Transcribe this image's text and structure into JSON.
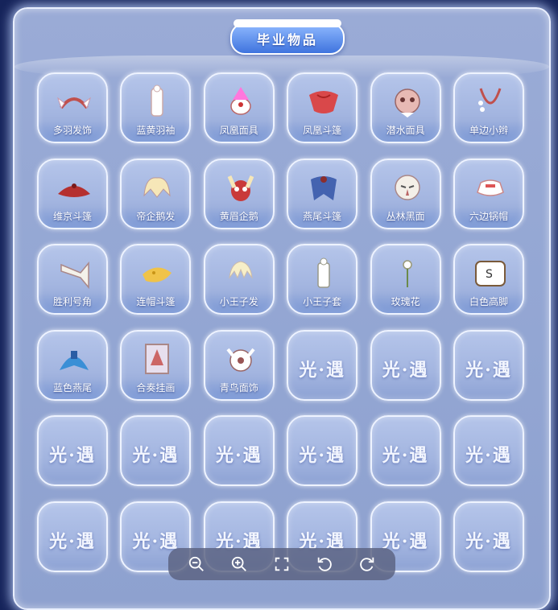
{
  "title": "毕业物品",
  "items": [
    {
      "label": "多羽发饰",
      "icon": "feather-headband-icon"
    },
    {
      "label": "蓝黄羽袖",
      "icon": "outfit-icon"
    },
    {
      "label": "凤凰面具",
      "icon": "phoenix-mask-icon"
    },
    {
      "label": "凤凰斗篷",
      "icon": "red-cape-icon"
    },
    {
      "label": "潜水面具",
      "icon": "diving-mask-icon"
    },
    {
      "label": "单边小辫",
      "icon": "braid-icon"
    },
    {
      "label": "维京斗篷",
      "icon": "dark-red-cape-icon"
    },
    {
      "label": "帝企鹅发",
      "icon": "penguin-hair-icon"
    },
    {
      "label": "黄眉企鹅",
      "icon": "penguin-mask-icon"
    },
    {
      "label": "燕尾斗篷",
      "icon": "blue-cape-icon"
    },
    {
      "label": "丛林黑面",
      "icon": "jungle-mask-icon"
    },
    {
      "label": "六边锅帽",
      "icon": "pot-hat-icon"
    },
    {
      "label": "胜利号角",
      "icon": "horn-icon"
    },
    {
      "label": "连帽斗篷",
      "icon": "yellow-cape-icon"
    },
    {
      "label": "小王子发",
      "icon": "hair-icon"
    },
    {
      "label": "小王子套",
      "icon": "prince-outfit-icon"
    },
    {
      "label": "玫瑰花",
      "icon": "rose-icon"
    },
    {
      "label": "白色高脚",
      "icon": "piano-icon"
    },
    {
      "label": "蓝色燕尾",
      "icon": "blue-tail-cape-icon"
    },
    {
      "label": "合奏挂画",
      "icon": "painting-icon"
    },
    {
      "label": "青鸟面饰",
      "icon": "bird-mask-icon"
    }
  ],
  "empty_logo": "光·遇",
  "empty_count": 15,
  "toolbar": [
    "zoom-out-icon",
    "zoom-in-icon",
    "fullscreen-icon",
    "rotate-left-icon",
    "rotate-right-icon"
  ]
}
